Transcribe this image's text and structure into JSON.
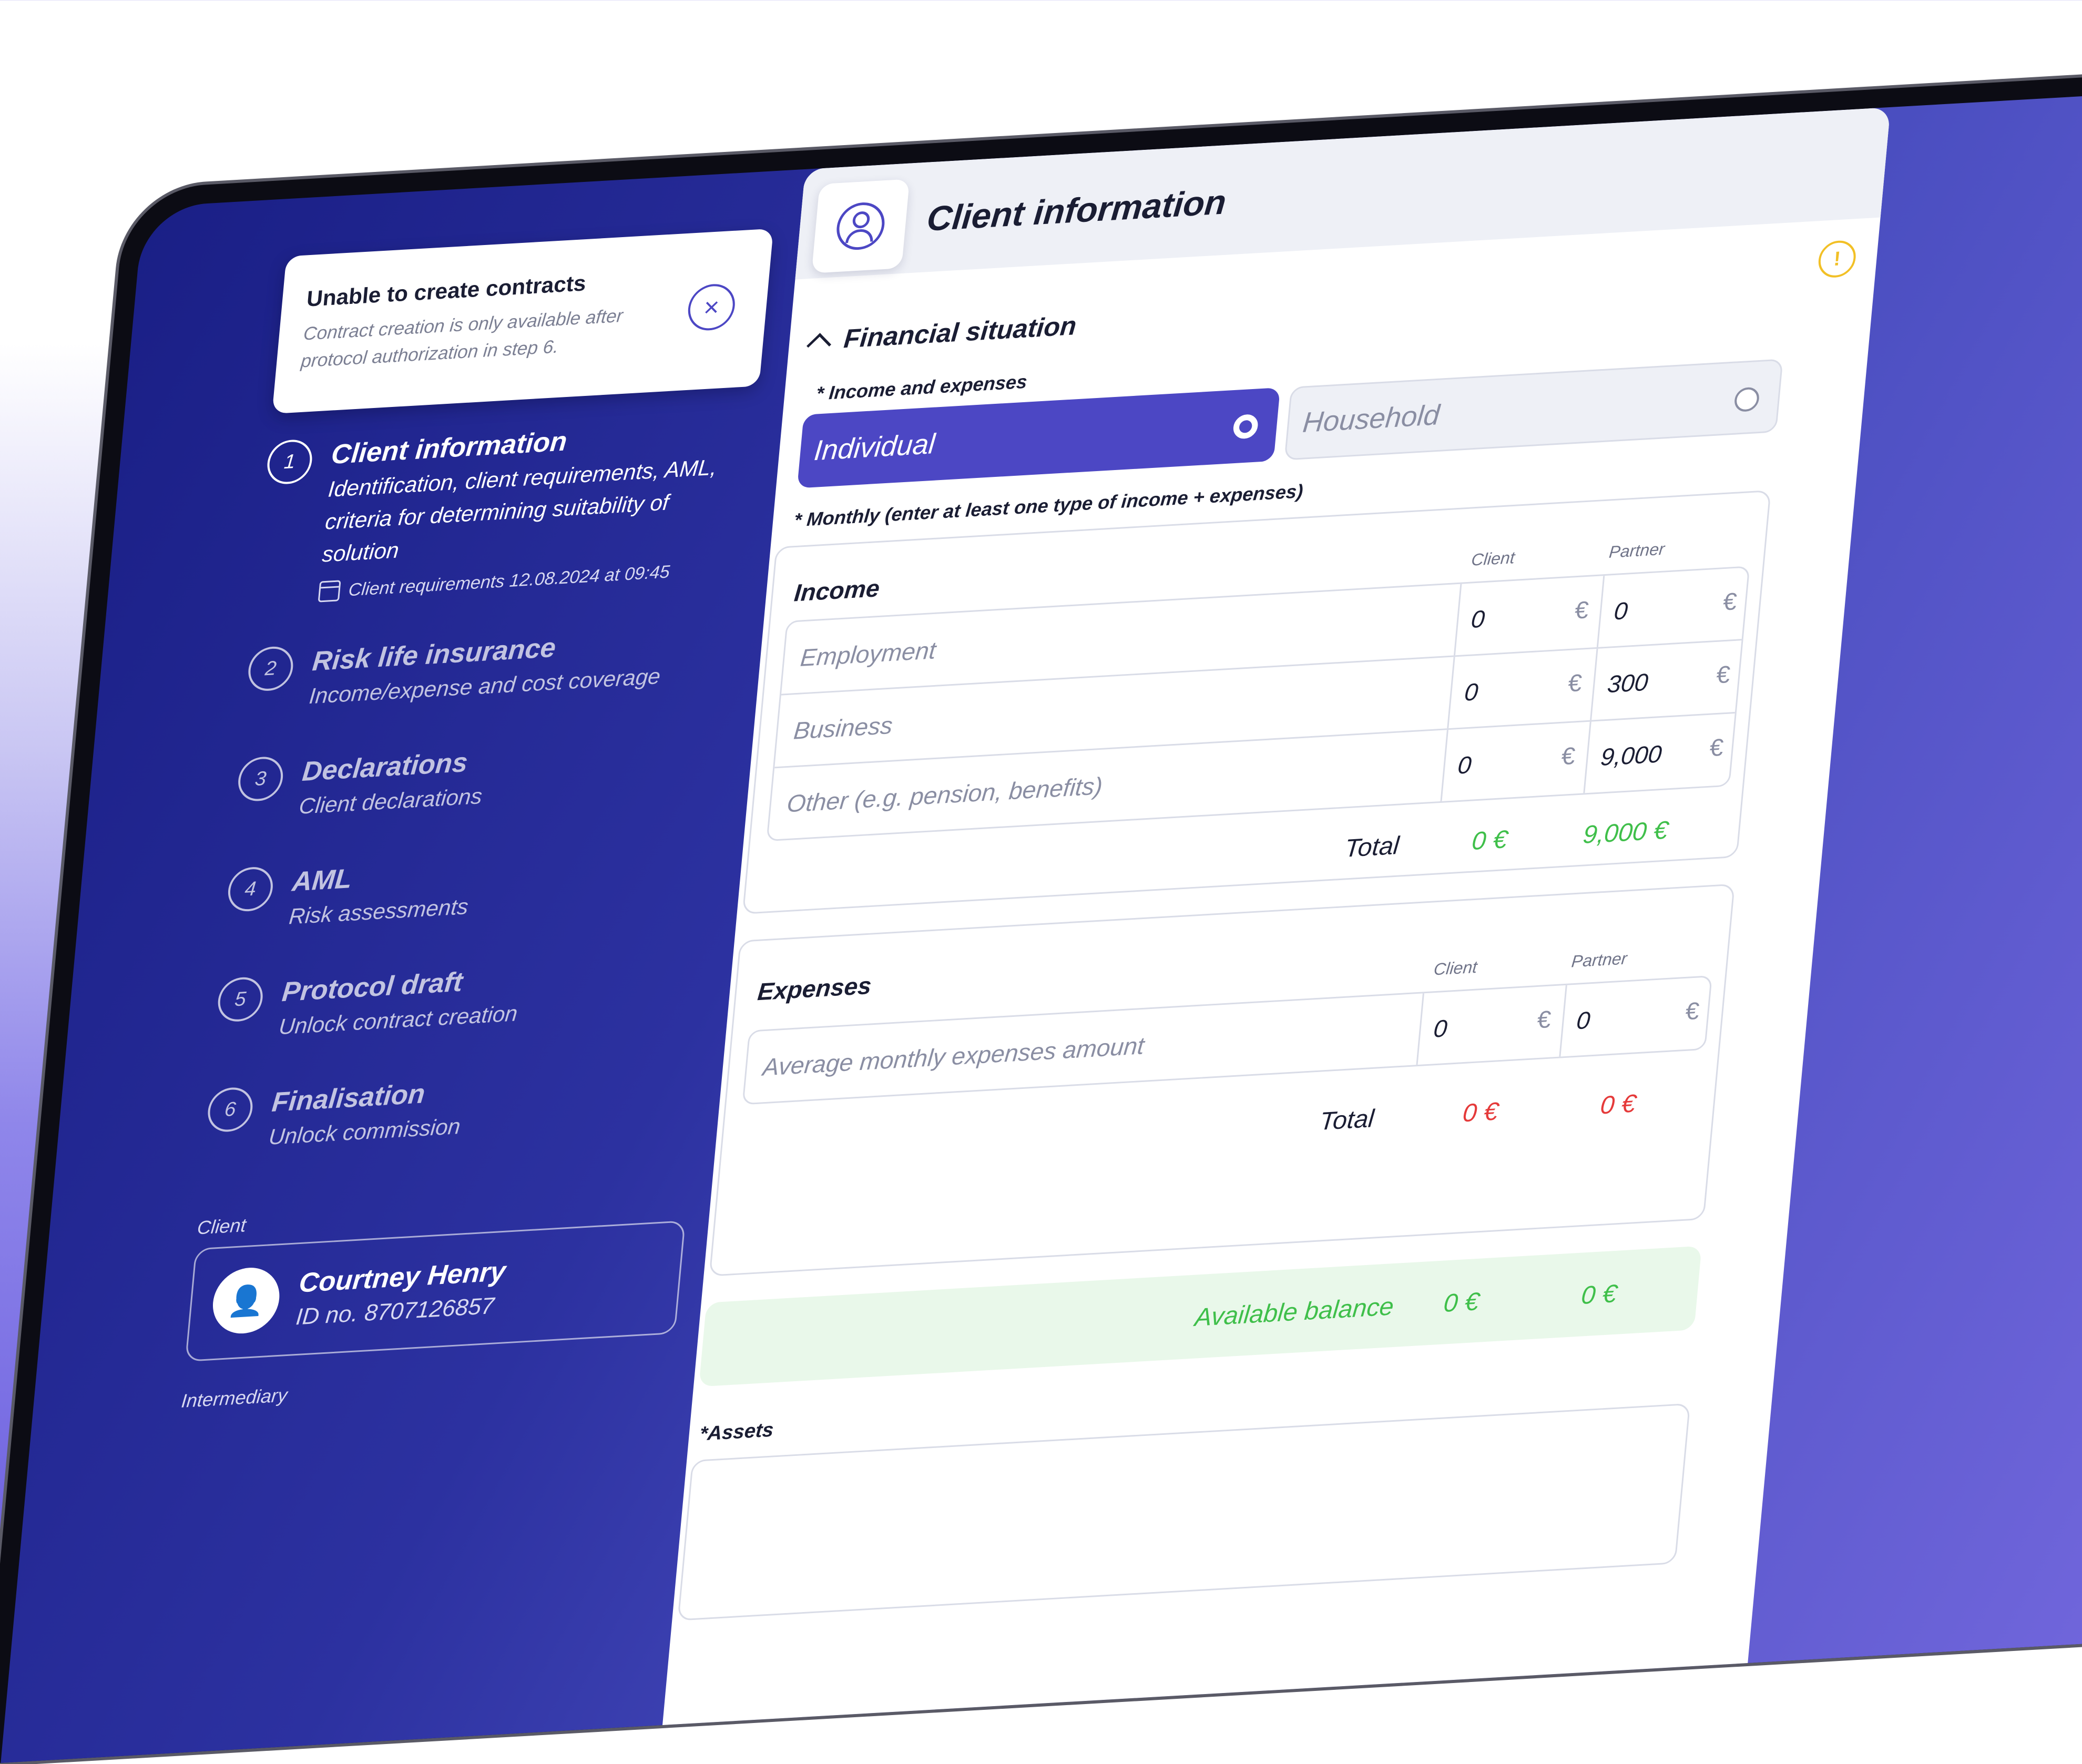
{
  "notice": {
    "title": "Unable to create contracts",
    "text": "Contract creation is only available after protocol authorization in step 6."
  },
  "steps": [
    {
      "num": "1",
      "title": "Client information",
      "subtitle": "Identification, client requirements, AML, criteria for determining suitability of solution",
      "date": "Client requirements 12.08.2024 at 09:45"
    },
    {
      "num": "2",
      "title": "Risk life insurance",
      "subtitle": "Income/expense and cost coverage"
    },
    {
      "num": "3",
      "title": "Declarations",
      "subtitle": "Client declarations"
    },
    {
      "num": "4",
      "title": "AML",
      "subtitle": "Risk assessments"
    },
    {
      "num": "5",
      "title": "Protocol draft",
      "subtitle": "Unlock contract creation"
    },
    {
      "num": "6",
      "title": "Finalisation",
      "subtitle": "Unlock commission"
    }
  ],
  "client": {
    "label": "Client",
    "name": "Courtney Henry",
    "id": "ID no. 8707126857"
  },
  "intermediary_label": "Intermediary",
  "panel": {
    "title": "Client information",
    "section": "Financial situation",
    "income_expenses_label": "* Income and expenses",
    "option_individual": "Individual",
    "option_household": "Household",
    "monthly_label": "* Monthly (enter at least one type of income + expenses)"
  },
  "income": {
    "title": "Income",
    "col_client": "Client",
    "col_partner": "Partner",
    "rows": [
      {
        "label": "Employment",
        "client": "0",
        "partner": "0"
      },
      {
        "label": "Business",
        "client": "0",
        "partner": "300"
      },
      {
        "label": "Other (e.g. pension, benefits)",
        "client": "0",
        "partner": "9,000"
      }
    ],
    "total_label": "Total",
    "total_client": "0 €",
    "total_partner": "9,000 €"
  },
  "expenses": {
    "title": "Expenses",
    "col_client": "Client",
    "col_partner": "Partner",
    "rows": [
      {
        "label": "Average monthly expenses amount",
        "client": "0",
        "partner": "0"
      }
    ],
    "total_label": "Total",
    "total_client": "0 €",
    "total_partner": "0 €"
  },
  "balance": {
    "label": "Available balance",
    "client": "0 €",
    "partner": "0 €"
  },
  "assets_label": "*Assets",
  "currency": "€",
  "colors": {
    "accent": "#4c47c4",
    "positive": "#3fbf4a",
    "negative": "#e53a3a",
    "warning": "#f2c026"
  }
}
